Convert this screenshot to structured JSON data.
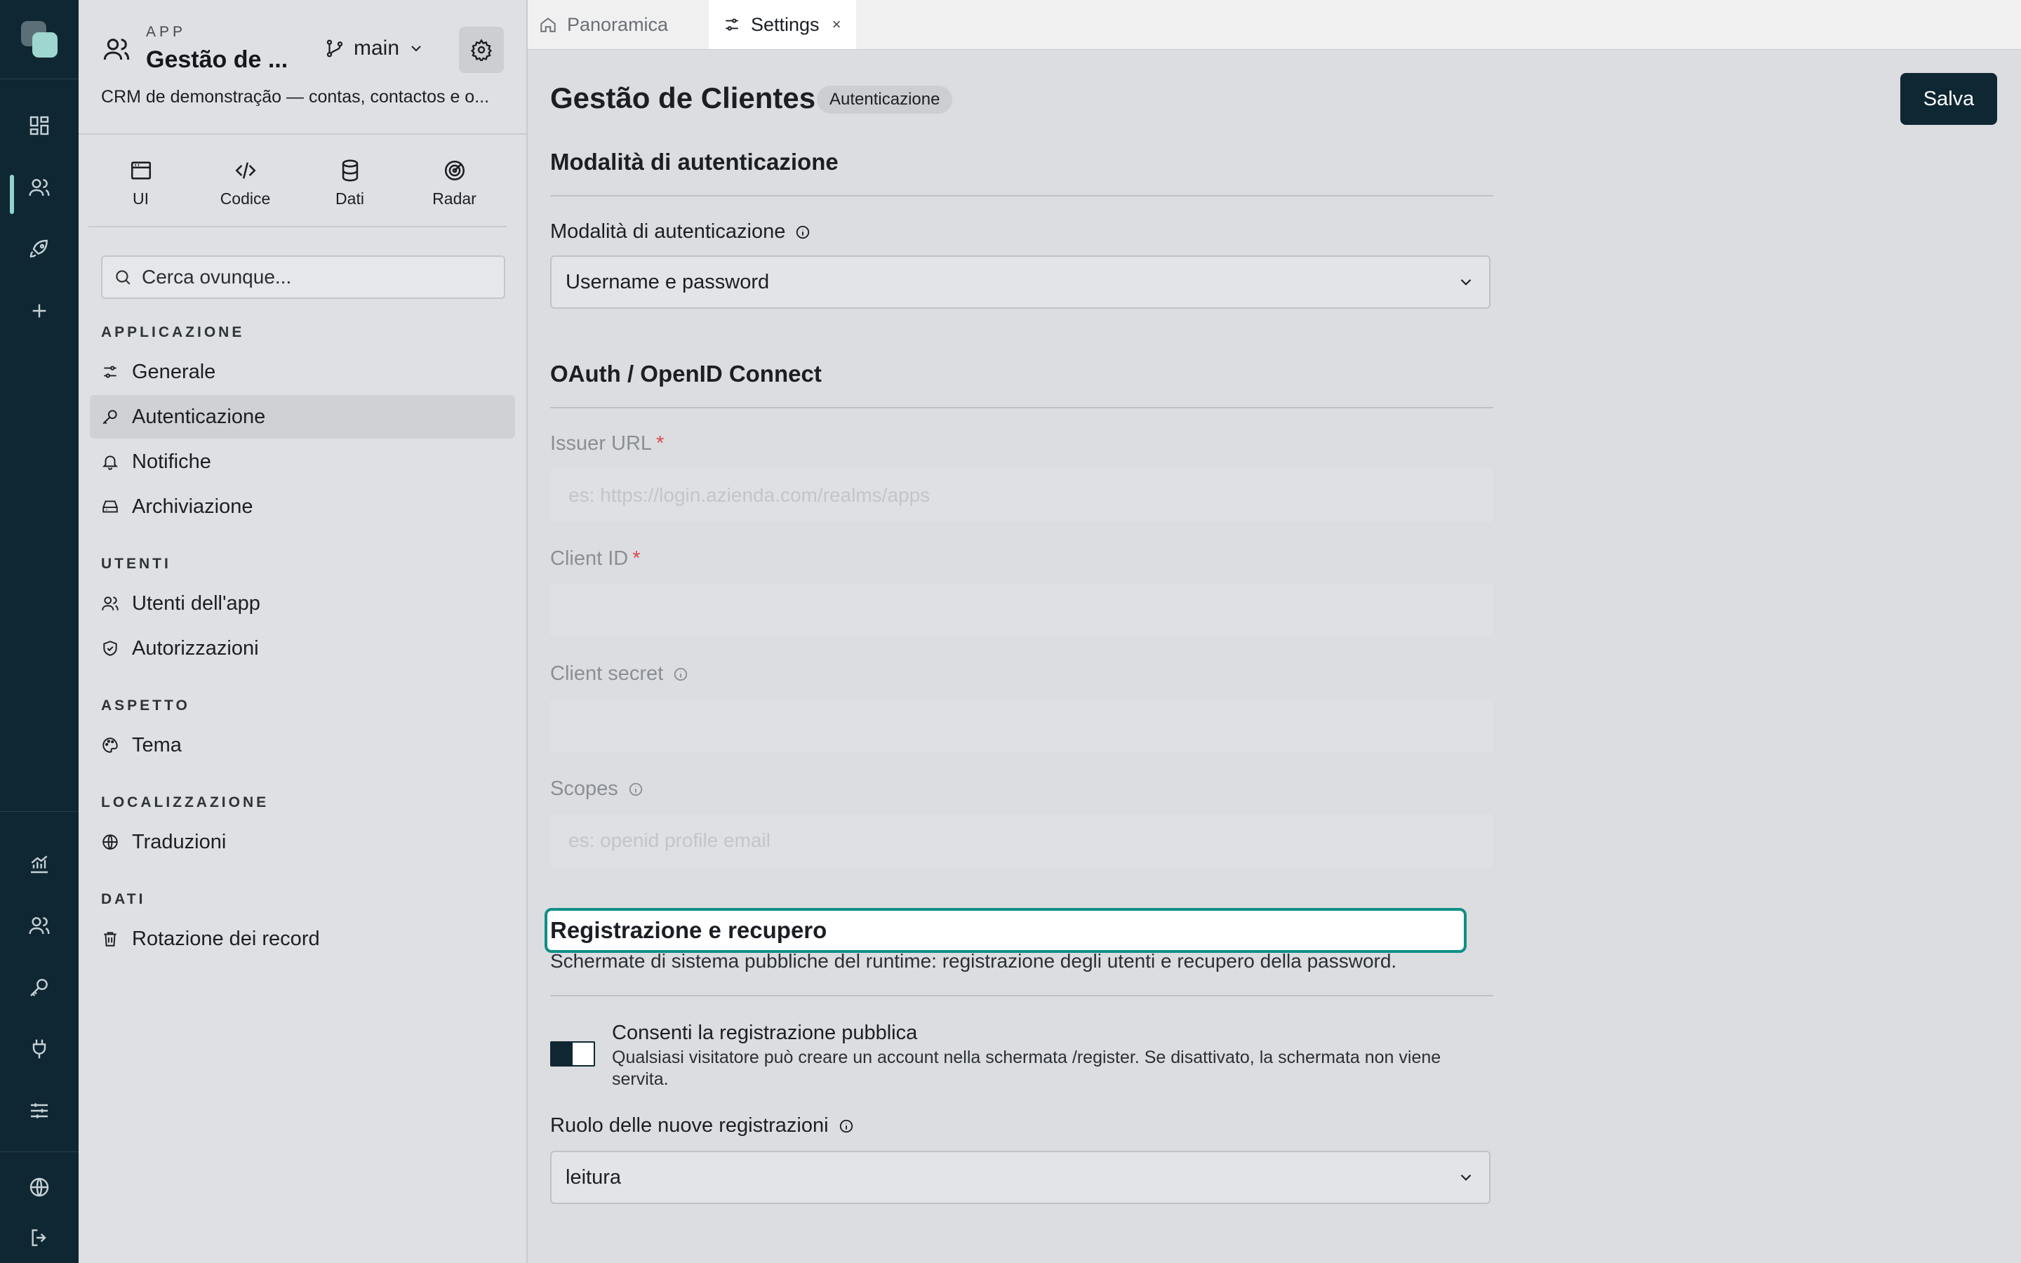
{
  "app": {
    "kicker": "APP",
    "name": "Gestão de ...",
    "branch": "main",
    "description": "CRM de demonstração — contas, contactos e o..."
  },
  "mode_tabs": [
    {
      "label": "UI",
      "icon": "browser-window-icon"
    },
    {
      "label": "Codice",
      "icon": "code-icon"
    },
    {
      "label": "Dati",
      "icon": "database-icon"
    },
    {
      "label": "Radar",
      "icon": "radar-icon"
    }
  ],
  "search": {
    "placeholder": "Cerca ovunque..."
  },
  "nav": {
    "sections": [
      {
        "title": "APPLICAZIONE",
        "items": [
          {
            "label": "Generale",
            "icon": "sliders-icon"
          },
          {
            "label": "Autenticazione",
            "icon": "key-icon",
            "active": true
          },
          {
            "label": "Notifiche",
            "icon": "bell-icon"
          },
          {
            "label": "Archiviazione",
            "icon": "hard-drive-icon"
          }
        ]
      },
      {
        "title": "UTENTI",
        "items": [
          {
            "label": "Utenti dell'app",
            "icon": "users-icon"
          },
          {
            "label": "Autorizzazioni",
            "icon": "shield-check-icon"
          }
        ]
      },
      {
        "title": "ASPETTO",
        "items": [
          {
            "label": "Tema",
            "icon": "palette-icon"
          }
        ]
      },
      {
        "title": "LOCALIZZAZIONE",
        "items": [
          {
            "label": "Traduzioni",
            "icon": "globe-icon"
          }
        ]
      },
      {
        "title": "DATI",
        "items": [
          {
            "label": "Rotazione dei record",
            "icon": "trash-icon"
          }
        ]
      }
    ]
  },
  "tabs": [
    {
      "label": "Panoramica",
      "icon": "home-icon",
      "active": false
    },
    {
      "label": "Settings",
      "icon": "sliders-icon",
      "active": true,
      "close": "×"
    }
  ],
  "page": {
    "title": "Gestão de Clientes",
    "badge": "Autenticazione",
    "save_label": "Salva"
  },
  "auth_mode": {
    "section_title": "Modalità di autenticazione",
    "field_label": "Modalità di autenticazione",
    "value": "Username e password"
  },
  "oauth": {
    "section_title": "OAuth / OpenID Connect",
    "issuer_label": "Issuer URL",
    "issuer_placeholder": "es: https://login.azienda.com/realms/apps",
    "client_id_label": "Client ID",
    "client_secret_label": "Client secret",
    "scopes_label": "Scopes",
    "scopes_placeholder": "es: openid profile email",
    "required_mark": "*"
  },
  "registration": {
    "section_title": "Registrazione e recupero",
    "description": "Schermate di sistema pubbliche del runtime: registrazione degli utenti e recupero della password.",
    "public_toggle_label": "Consenti la registrazione pubblica",
    "public_toggle_help": "Qualsiasi visitatore può creare un account nella schermata /register. Se disattivato, la schermata non viene servita.",
    "public_toggle_on": true,
    "role_label": "Ruolo delle nuove registrazioni",
    "role_value": "leitura"
  },
  "colors": {
    "rail": "#0f2733",
    "accent": "#8fd3cc",
    "focus_ring": "#0f8f86",
    "required": "#d94b4b"
  }
}
